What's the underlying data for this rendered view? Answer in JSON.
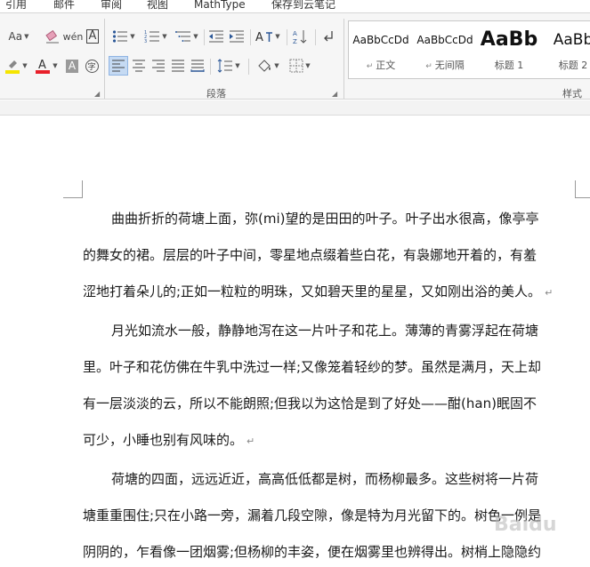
{
  "menu_tabs": [
    "引用",
    "邮件",
    "审阅",
    "视图",
    "MathType",
    "保存到云笔记"
  ],
  "ribbon": {
    "font_group": {
      "font_size_label": "Aa"
    },
    "paragraph_group": {
      "label": "段落"
    },
    "styles_group": {
      "label": "样式",
      "styles": [
        {
          "preview": "AaBbCcDd",
          "name": "正文"
        },
        {
          "preview": "AaBbCcDd",
          "name": "无间隔"
        },
        {
          "preview": "AaBb",
          "name": "标题 1"
        },
        {
          "preview": "AaBb",
          "name": "标题 2"
        }
      ]
    },
    "colors": {
      "highlight": "#f5e500",
      "font_color": "#e8202a",
      "selected_bg": "#c5daf3"
    }
  },
  "document": {
    "paragraphs": [
      {
        "lines": [
          "曲曲折折的荷塘上面，弥(mi)望的是田田的叶子。叶子出水很高，像亭亭",
          "的舞女的裙。层层的叶子中间，零星地点缀着些白花，有袅娜地开着的，有羞",
          "涩地打着朵儿的;正如一粒粒的明珠，又如碧天里的星星，又如刚出浴的美人。"
        ]
      },
      {
        "lines": [
          "月光如流水一般，静静地泻在这一片叶子和花上。薄薄的青雾浮起在荷塘",
          "里。叶子和花仿佛在牛乳中洗过一样;又像笼着轻纱的梦。虽然是满月，天上却",
          "有一层淡淡的云，所以不能朗照;但我以为这恰是到了好处——酣(han)眠固不",
          "可少，小睡也别有风味的。"
        ]
      },
      {
        "lines": [
          "荷塘的四面，远远近近，高高低低都是树，而杨柳最多。这些树将一片荷",
          "塘重重围住;只在小路一旁，漏着几段空隙，像是特为月光留下的。树色一例是",
          "阴阴的，乍看像一团烟雾;但杨柳的丰姿，便在烟雾里也辨得出。树梢上隐隐约"
        ]
      }
    ],
    "paragraph_mark": "↵"
  },
  "watermark": "Baidu"
}
